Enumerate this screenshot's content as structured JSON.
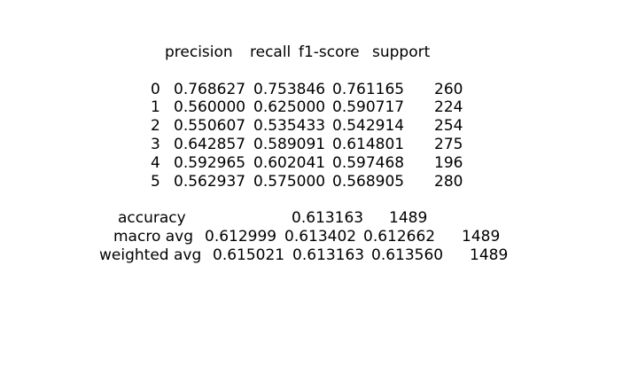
{
  "report": {
    "header": [
      "precision",
      "recall",
      "f1-score",
      "support"
    ],
    "class_rows": [
      {
        "label": "0",
        "precision": "0.768627",
        "recall": "0.753846",
        "f1": "0.761165",
        "support": "260"
      },
      {
        "label": "1",
        "precision": "0.560000",
        "recall": "0.625000",
        "f1": "0.590717",
        "support": "224"
      },
      {
        "label": "2",
        "precision": "0.550607",
        "recall": "0.535433",
        "f1": "0.542914",
        "support": "254"
      },
      {
        "label": "3",
        "precision": "0.642857",
        "recall": "0.589091",
        "f1": "0.614801",
        "support": "275"
      },
      {
        "label": "4",
        "precision": "0.592965",
        "recall": "0.602041",
        "f1": "0.597468",
        "support": "196"
      },
      {
        "label": "5",
        "precision": "0.562937",
        "recall": "0.575000",
        "f1": "0.568905",
        "support": "280"
      }
    ],
    "accuracy": {
      "label": "accuracy",
      "value": "0.613163",
      "support": "1489"
    },
    "macro_avg": {
      "label": "macro avg",
      "precision": "0.612999",
      "recall": "0.613402",
      "f1": "0.612662",
      "support": "1489"
    },
    "weighted_avg": {
      "label": "weighted avg",
      "precision": "0.615021",
      "recall": "0.613163",
      "f1": "0.613560",
      "support": "1489"
    }
  }
}
